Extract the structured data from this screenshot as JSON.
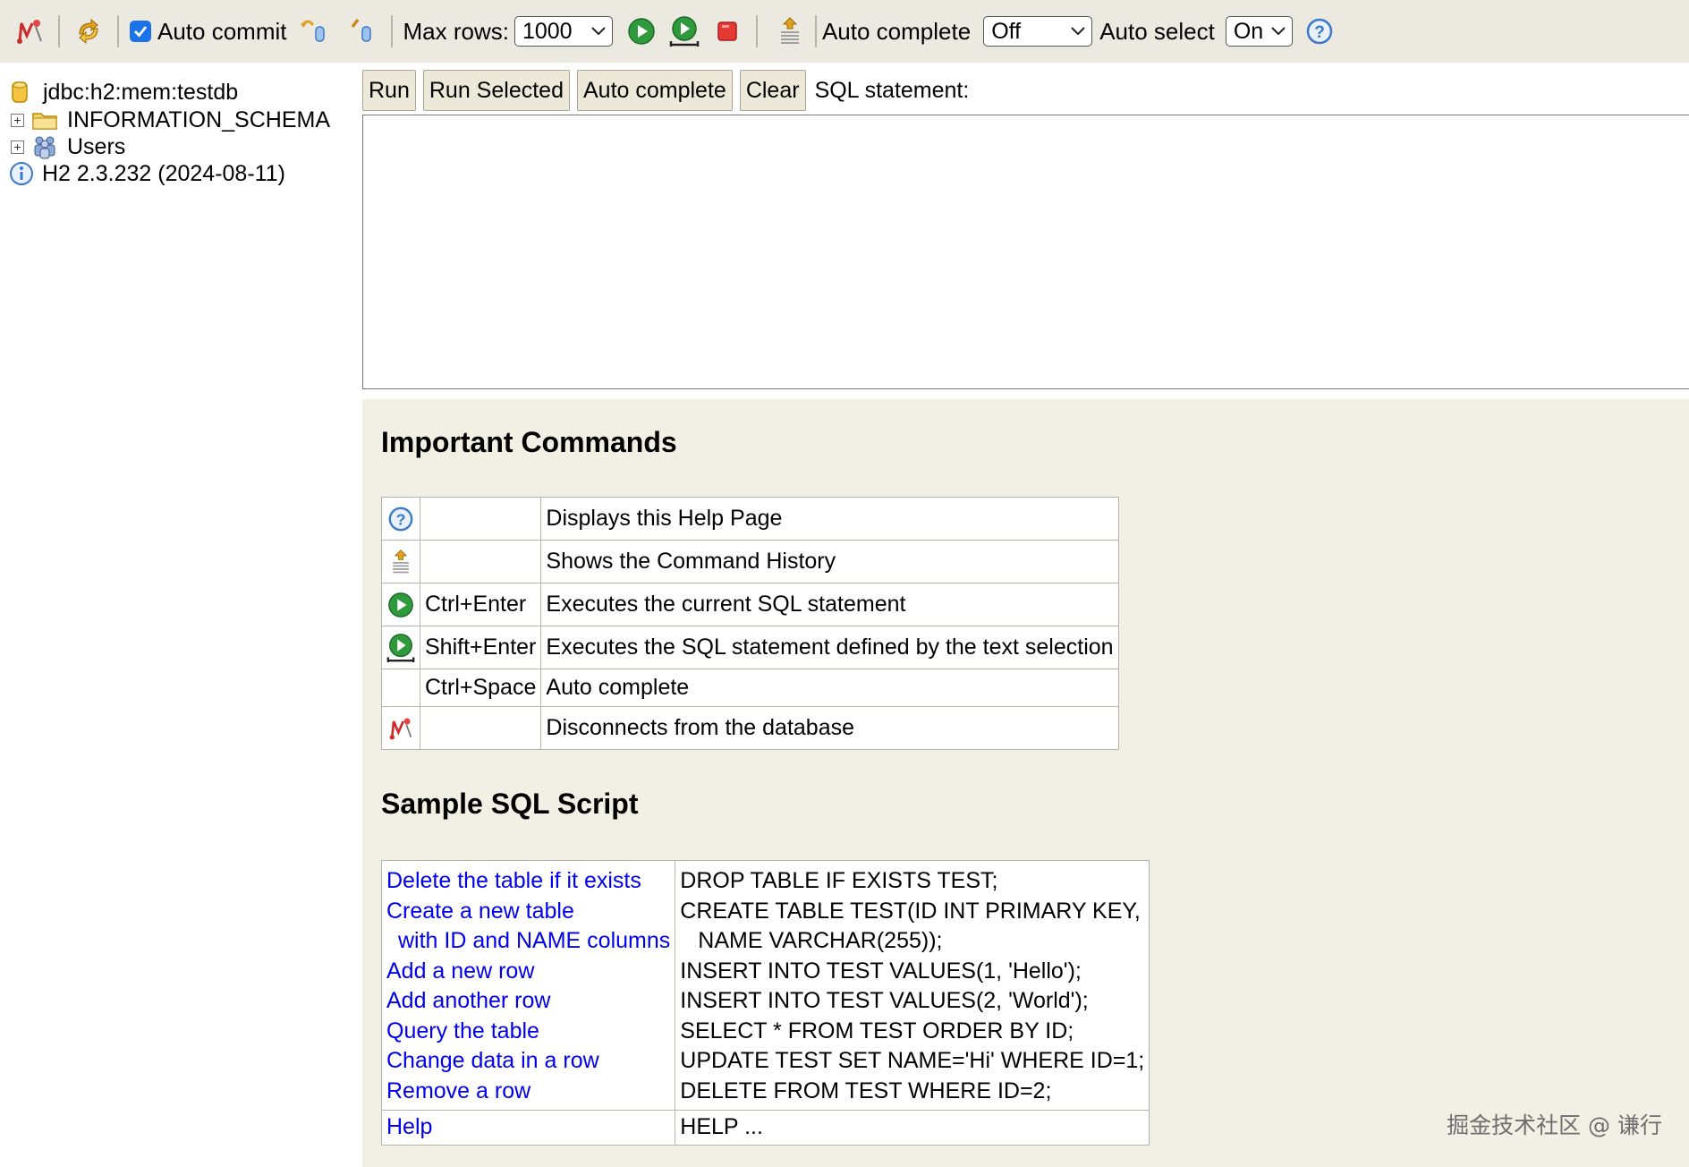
{
  "toolbar": {
    "auto_commit_label": "Auto commit",
    "max_rows_label": "Max rows:",
    "max_rows_value": "1000",
    "auto_complete_label": "Auto complete",
    "auto_complete_value": "Off",
    "auto_select_label": "Auto select",
    "auto_select_value": "On",
    "icons": [
      "disconnect-icon",
      "refresh-icon",
      "rollback-icon",
      "commit-icon",
      "run-icon",
      "run-selected-icon",
      "stop-icon",
      "history-icon",
      "help-icon"
    ]
  },
  "tree": {
    "connection": "jdbc:h2:mem:testdb",
    "schema": "INFORMATION_SCHEMA",
    "users": "Users",
    "version": "H2 2.3.232 (2024-08-11)"
  },
  "buttons": {
    "run": "Run",
    "run_selected": "Run Selected",
    "auto_complete": "Auto complete",
    "clear": "Clear",
    "sql_statement_label": "SQL statement:"
  },
  "sql_editor": {
    "value": ""
  },
  "help": {
    "important_title": "Important Commands",
    "commands": [
      {
        "icon": "help-icon",
        "shortcut": "",
        "description": "Displays this Help Page"
      },
      {
        "icon": "history-icon",
        "shortcut": "",
        "description": "Shows the Command History"
      },
      {
        "icon": "run-icon",
        "shortcut": "Ctrl+Enter",
        "description": "Executes the current SQL statement"
      },
      {
        "icon": "run-selected-icon",
        "shortcut": "Shift+Enter",
        "description": "Executes the SQL statement defined by the text selection"
      },
      {
        "icon": "",
        "shortcut": "Ctrl+Space",
        "description": "Auto complete"
      },
      {
        "icon": "disconnect-icon",
        "shortcut": "",
        "description": "Disconnects from the database"
      }
    ],
    "sample_title": "Sample SQL Script",
    "sample": [
      {
        "link": "Delete the table if it exists",
        "sql": "DROP TABLE IF EXISTS TEST;"
      },
      {
        "link": "Create a new table",
        "sql": "CREATE TABLE TEST(ID INT PRIMARY KEY,"
      },
      {
        "link": "with ID and NAME columns",
        "sql": "NAME VARCHAR(255));"
      },
      {
        "link": "Add a new row",
        "sql": "INSERT INTO TEST VALUES(1, 'Hello');"
      },
      {
        "link": "Add another row",
        "sql": "INSERT INTO TEST VALUES(2, 'World');"
      },
      {
        "link": "Query the table",
        "sql": "SELECT * FROM TEST ORDER BY ID;"
      },
      {
        "link": "Change data in a row",
        "sql": "UPDATE TEST SET NAME='Hi' WHERE ID=1;"
      },
      {
        "link": "Remove a row",
        "sql": "DELETE FROM TEST WHERE ID=2;"
      }
    ],
    "help_row": {
      "link": "Help",
      "sql": "HELP ..."
    }
  },
  "watermark": "掘金技术社区 @ 谦行",
  "colors": {
    "toolbar_bg": "#ece9e1",
    "help_bg": "#f2efe4",
    "link": "#0000ee",
    "run_green": "#2e9a3b",
    "stop_red": "#e53935",
    "checkbox_blue": "#1a73e8"
  }
}
